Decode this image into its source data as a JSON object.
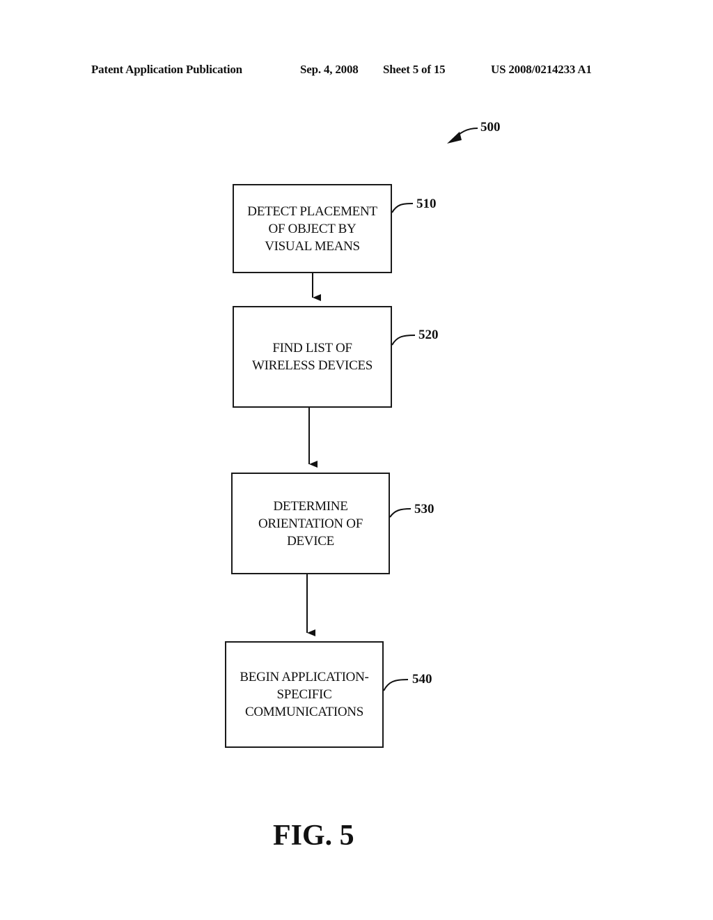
{
  "header": {
    "publication": "Patent Application Publication",
    "date": "Sep. 4, 2008",
    "sheet": "Sheet 5 of 15",
    "number": "US 2008/0214233 A1"
  },
  "diagram": {
    "ref": "500",
    "steps": [
      {
        "id": "510",
        "text": "DETECT PLACEMENT\nOF OBJECT BY\nVISUAL MEANS"
      },
      {
        "id": "520",
        "text": "FIND LIST OF\nWIRELESS DEVICES"
      },
      {
        "id": "530",
        "text": "DETERMINE\nORIENTATION OF\nDEVICE"
      },
      {
        "id": "540",
        "text": "BEGIN APPLICATION-\nSPECIFIC\nCOMMUNICATIONS"
      }
    ],
    "flow": [
      "510 -> 520",
      "520 -> 530",
      "530 -> 540"
    ]
  },
  "figure_label": "FIG. 5"
}
